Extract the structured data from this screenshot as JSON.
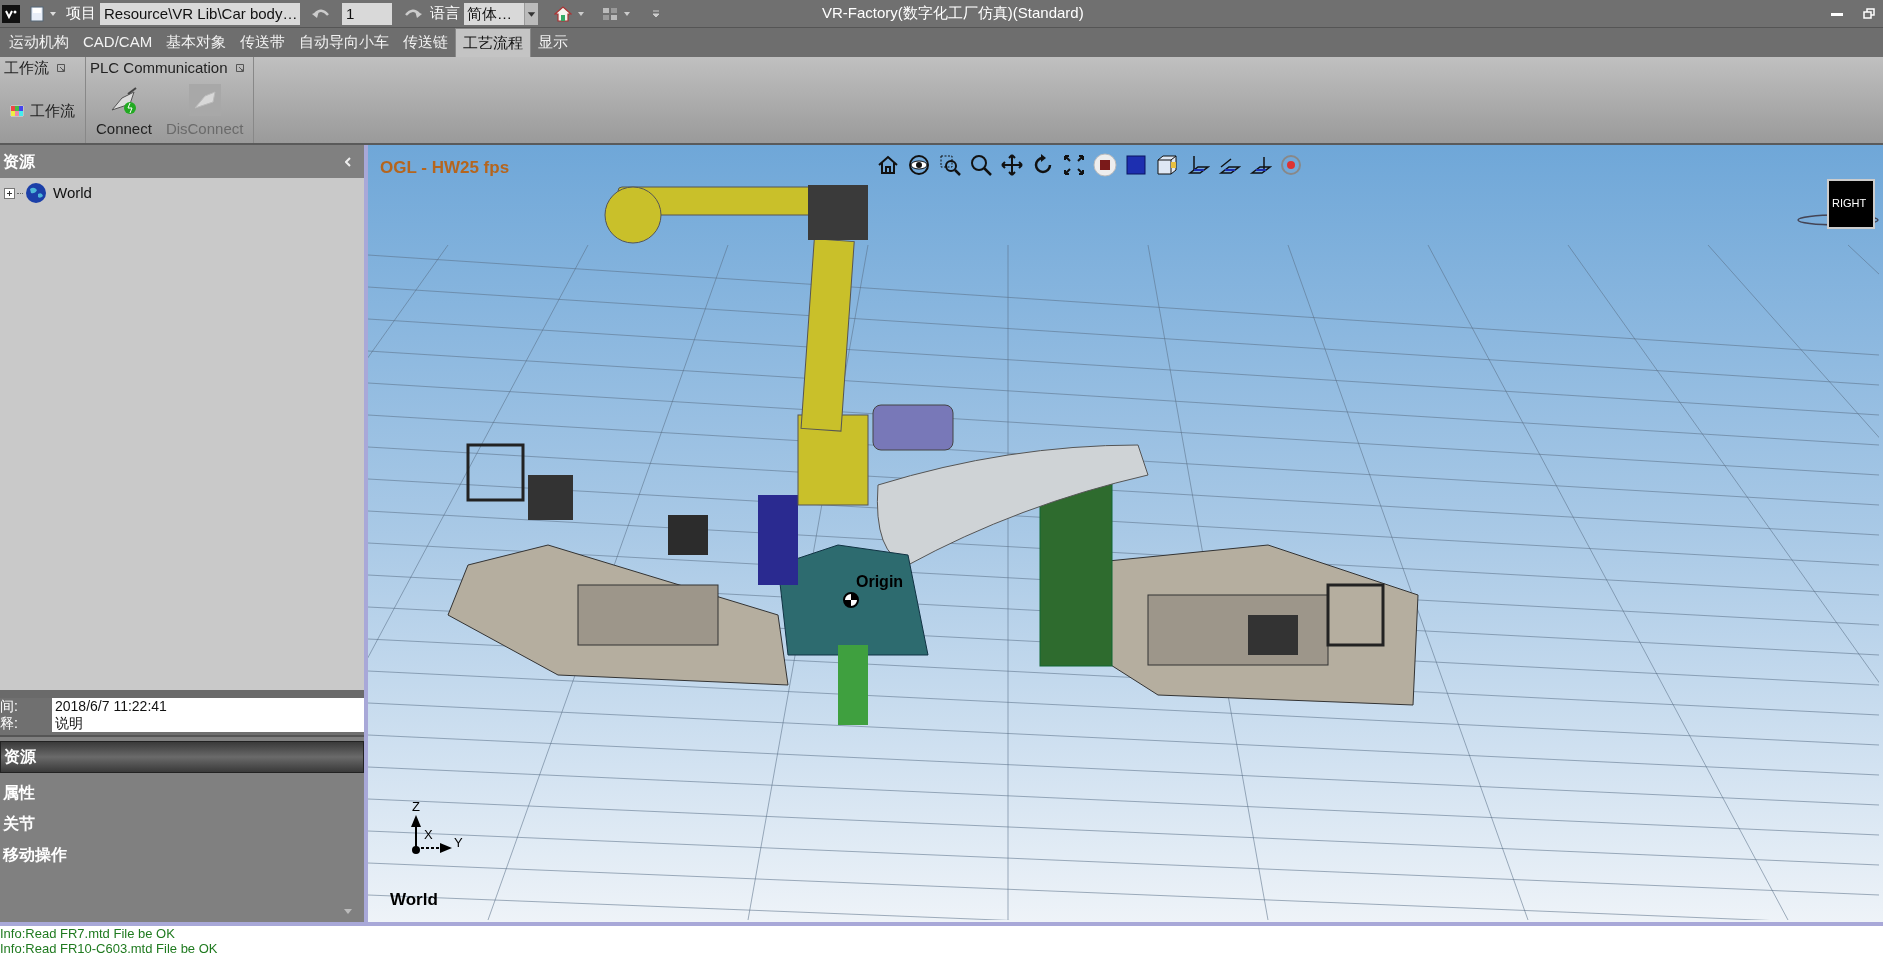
{
  "window": {
    "title": "VR-Factory(数字化工厂仿真)(Standard)"
  },
  "quick_access": {
    "project_label": "项目",
    "project_value": "Resource\\VR Lib\\Car body…",
    "step_value": "1",
    "language_label": "语言",
    "language_value": "简体…"
  },
  "ribbon_tabs": [
    {
      "label": "运动机构",
      "selected": false
    },
    {
      "label": "CAD/CAM",
      "selected": false
    },
    {
      "label": "基本对象",
      "selected": false
    },
    {
      "label": "传送带",
      "selected": false
    },
    {
      "label": "自动导向小车",
      "selected": false
    },
    {
      "label": "传送链",
      "selected": false
    },
    {
      "label": "工艺流程",
      "selected": true
    },
    {
      "label": "显示",
      "selected": false
    }
  ],
  "ribbon_groups": [
    {
      "title": "工作流",
      "buttons": [
        {
          "label": "工作流",
          "kind": "small",
          "disabled": false
        }
      ]
    },
    {
      "title": "PLC Communication",
      "buttons": [
        {
          "label": "Connect",
          "kind": "large",
          "disabled": false
        },
        {
          "label": "DisConnect",
          "kind": "large",
          "disabled": true
        }
      ]
    }
  ],
  "resource_panel": {
    "title": "资源",
    "tree": [
      {
        "label": "World",
        "expanded": false
      }
    ]
  },
  "properties": [
    {
      "label": "间:",
      "value": "2018/6/7 11:22:41"
    },
    {
      "label": "释:",
      "value": "说明"
    }
  ],
  "nav_sections": [
    {
      "label": "资源",
      "selected": true
    },
    {
      "label": "属性",
      "selected": false
    },
    {
      "label": "关节",
      "selected": false
    },
    {
      "label": "移动操作",
      "selected": false
    }
  ],
  "viewport": {
    "fps_label": "OGL - HW25 fps",
    "origin_label": "Origin",
    "view_cube_label": "RIGHT",
    "axes": {
      "z": "Z",
      "x": "X",
      "y": "Y"
    },
    "frame_label": "World"
  },
  "log": [
    "Info:Read FR7.mtd File be OK",
    "Info:Read FR10-C603.mtd File be OK"
  ]
}
